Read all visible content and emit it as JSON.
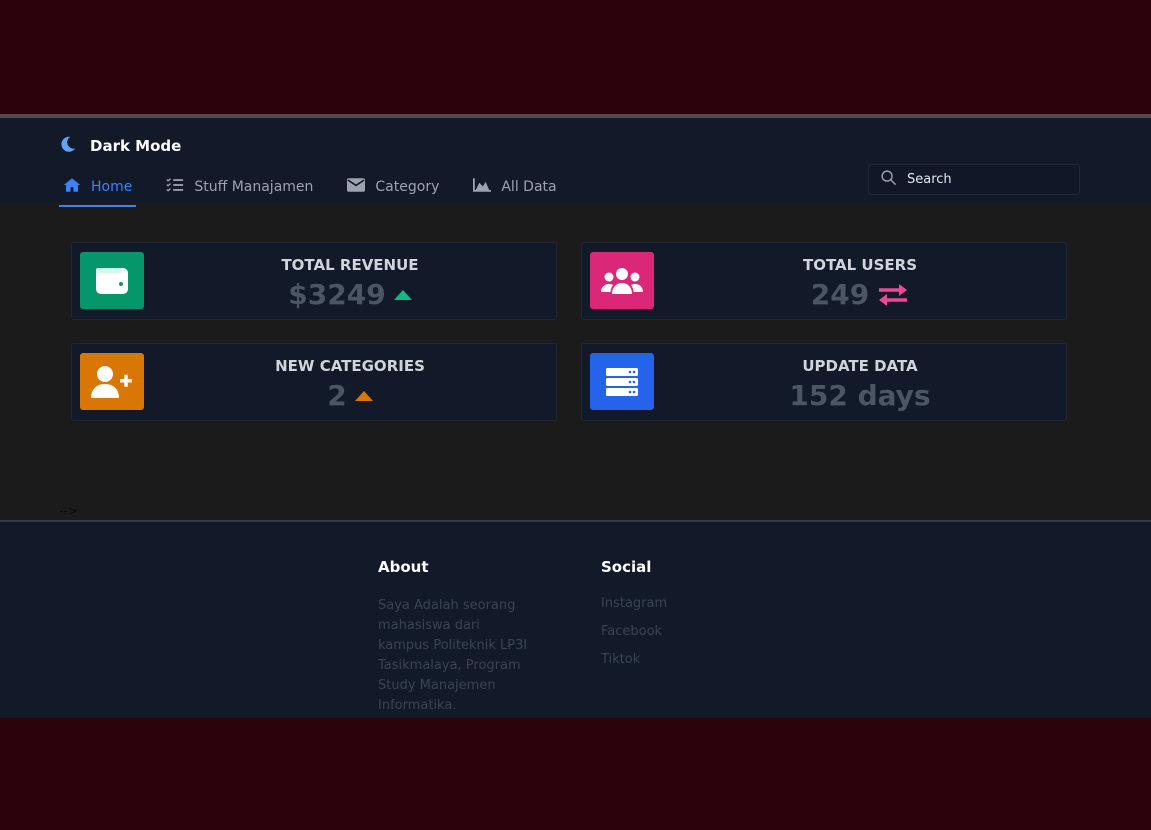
{
  "header": {
    "title": "Dark Mode",
    "icon": "moon-icon"
  },
  "nav": {
    "items": [
      {
        "label": "Home",
        "icon": "home-icon",
        "active": true
      },
      {
        "label": "Stuff Manajamen",
        "icon": "list-icon",
        "active": false
      },
      {
        "label": "Category",
        "icon": "envelope-icon",
        "active": false
      },
      {
        "label": "All Data",
        "icon": "chart-area-icon",
        "active": false
      }
    ]
  },
  "search": {
    "placeholder": "Search"
  },
  "cards": [
    {
      "label": "TOTAL REVENUE",
      "value": "$3249",
      "icon": "wallet-icon",
      "color": "#059669",
      "indicator": "caret-up-icon",
      "indicator_color": "#10b981"
    },
    {
      "label": "TOTAL USERS",
      "value": "249",
      "icon": "users-icon",
      "color": "#db2777",
      "indicator": "exchange-icon",
      "indicator_color": "#ec4899"
    },
    {
      "label": "NEW CATEGORIES",
      "value": "2",
      "icon": "user-plus-icon",
      "color": "#d97706",
      "indicator": "caret-up-icon",
      "indicator_color": "#d97706"
    },
    {
      "label": "UPDATE DATA",
      "value": "152 days",
      "icon": "server-icon",
      "color": "#2563eb"
    }
  ],
  "stray_text": "-->",
  "footer": {
    "about": {
      "heading": "About",
      "text": "Saya Adalah seorang mahasiswa dari kampus Politeknik LP3I Tasikmalaya, Program Study Manajemen Informatika."
    },
    "social": {
      "heading": "Social",
      "links": [
        "Instagram",
        "Facebook",
        "Tiktok"
      ]
    }
  }
}
